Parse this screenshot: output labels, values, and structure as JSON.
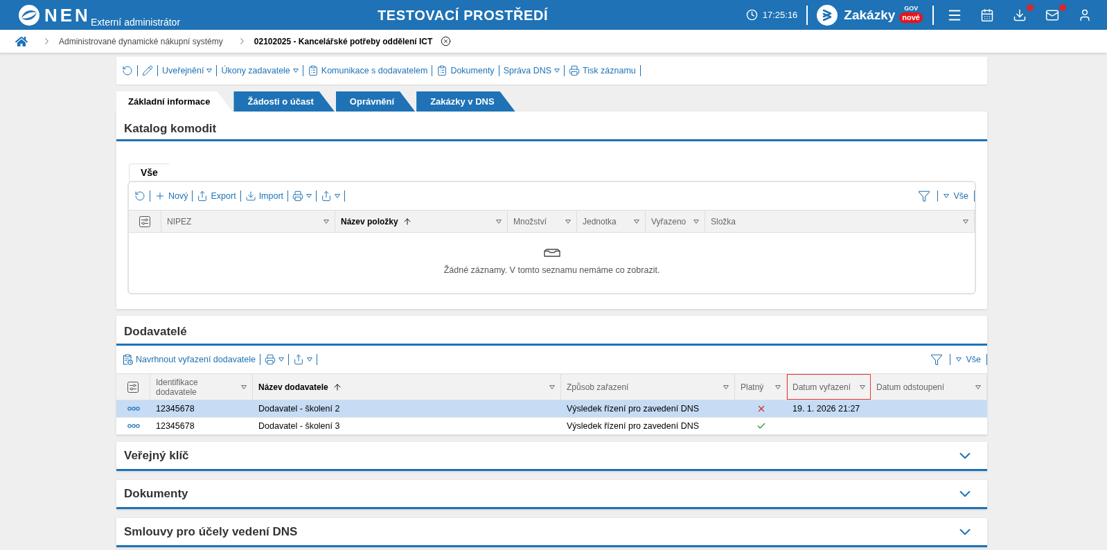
{
  "header": {
    "app_name": "NEN",
    "role": "Externí administrátor",
    "environment": "TESTOVACÍ PROSTŘEDÍ",
    "time": "17:25:16",
    "portal": {
      "name": "Zakázky",
      "superscript": "GOV",
      "badge": "nové"
    },
    "actions": [
      {
        "kind": "menu",
        "alert": false
      },
      {
        "kind": "calendar",
        "alert": false
      },
      {
        "kind": "download",
        "alert": true
      },
      {
        "kind": "mail",
        "alert": true
      },
      {
        "kind": "user",
        "alert": false
      }
    ]
  },
  "breadcrumb": [
    {
      "label": "Administrované dynamické nákupní systémy",
      "current": false
    },
    {
      "label": "02102025 - Kancelářské potřeby oddělení ICT",
      "current": true
    }
  ],
  "toolbar": [
    {
      "kind": "refresh",
      "dropdown": false
    },
    {
      "kind": "edit",
      "dropdown": false
    },
    {
      "kind": "text",
      "label": "Uveřejnění",
      "dropdown": true
    },
    {
      "kind": "text",
      "label": "Úkony zadavatele",
      "dropdown": true
    },
    {
      "kind": "clipboard",
      "label": "Komunikace s dodavatelem",
      "dropdown": false
    },
    {
      "kind": "clipboard",
      "label": "Dokumenty",
      "dropdown": false
    },
    {
      "kind": "text",
      "label": "Správa DNS",
      "dropdown": true
    },
    {
      "kind": "printer",
      "label": "Tisk záznamu",
      "dropdown": false
    }
  ],
  "tabs": [
    {
      "label": "Základní informace",
      "selected": true
    },
    {
      "label": "Žádosti o účast",
      "selected": false
    },
    {
      "label": "Oprávnění",
      "selected": false
    },
    {
      "label": "Zakázky v DNS",
      "selected": false
    }
  ],
  "catalog": {
    "title": "Katalog komodit",
    "views": [
      {
        "label": "Vše",
        "selected": true
      }
    ],
    "toolbar": [
      {
        "kind": "refresh",
        "dropdown": false
      },
      {
        "kind": "plus",
        "label": "Nový",
        "dropdown": false
      },
      {
        "kind": "export",
        "label": "Export",
        "dropdown": false
      },
      {
        "kind": "import",
        "label": "Import",
        "dropdown": false
      },
      {
        "kind": "printer",
        "dropdown": true
      },
      {
        "kind": "export",
        "dropdown": true
      }
    ],
    "filter": {
      "label": "Vše"
    },
    "columns": [
      {
        "label": "NIPEZ",
        "sorted": false
      },
      {
        "label": "Název položky",
        "sorted": true
      },
      {
        "label": "Množství",
        "sorted": false
      },
      {
        "label": "Jednotka",
        "sorted": false
      },
      {
        "label": "Vyřazeno",
        "sorted": false
      },
      {
        "label": "Složka",
        "sorted": false
      }
    ],
    "empty_message": "Žádné záznamy. V tomto seznamu nemáme co zobrazit."
  },
  "suppliers": {
    "title": "Dodavatelé",
    "toolbar": [
      {
        "kind": "propose",
        "label": "Navrhnout vyřazení dodavatele",
        "dropdown": false
      },
      {
        "kind": "printer",
        "dropdown": true
      },
      {
        "kind": "export",
        "dropdown": true
      }
    ],
    "filter": {
      "label": "Vše"
    },
    "columns": [
      {
        "label": "Identifikace dodavatele",
        "sorted": false,
        "highlighted": false
      },
      {
        "label": "Název dodavatele",
        "sorted": true,
        "highlighted": false
      },
      {
        "label": "Způsob zařazení",
        "sorted": false,
        "highlighted": false
      },
      {
        "label": "Platný",
        "sorted": false,
        "highlighted": false
      },
      {
        "label": "Datum vyřazení",
        "sorted": false,
        "highlighted": true
      },
      {
        "label": "Datum odstoupení",
        "sorted": false,
        "highlighted": false
      }
    ],
    "rows": [
      {
        "selected": true,
        "id": "12345678",
        "name": "Dodavatel - školení 2",
        "method": "Výsledek řízení pro zavedení DNS",
        "valid": false,
        "removed_date": "19. 1. 2026 21:27"
      },
      {
        "selected": false,
        "id": "12345678",
        "name": "Dodavatel - školení 3",
        "method": "Výsledek řízení pro zavedení DNS",
        "valid": true
      }
    ]
  },
  "sections": [
    {
      "title": "Veřejný klíč",
      "expanded": false
    },
    {
      "title": "Dokumenty",
      "expanded": false
    },
    {
      "title": "Smlouvy pro účely vedení DNS",
      "expanded": false
    }
  ]
}
